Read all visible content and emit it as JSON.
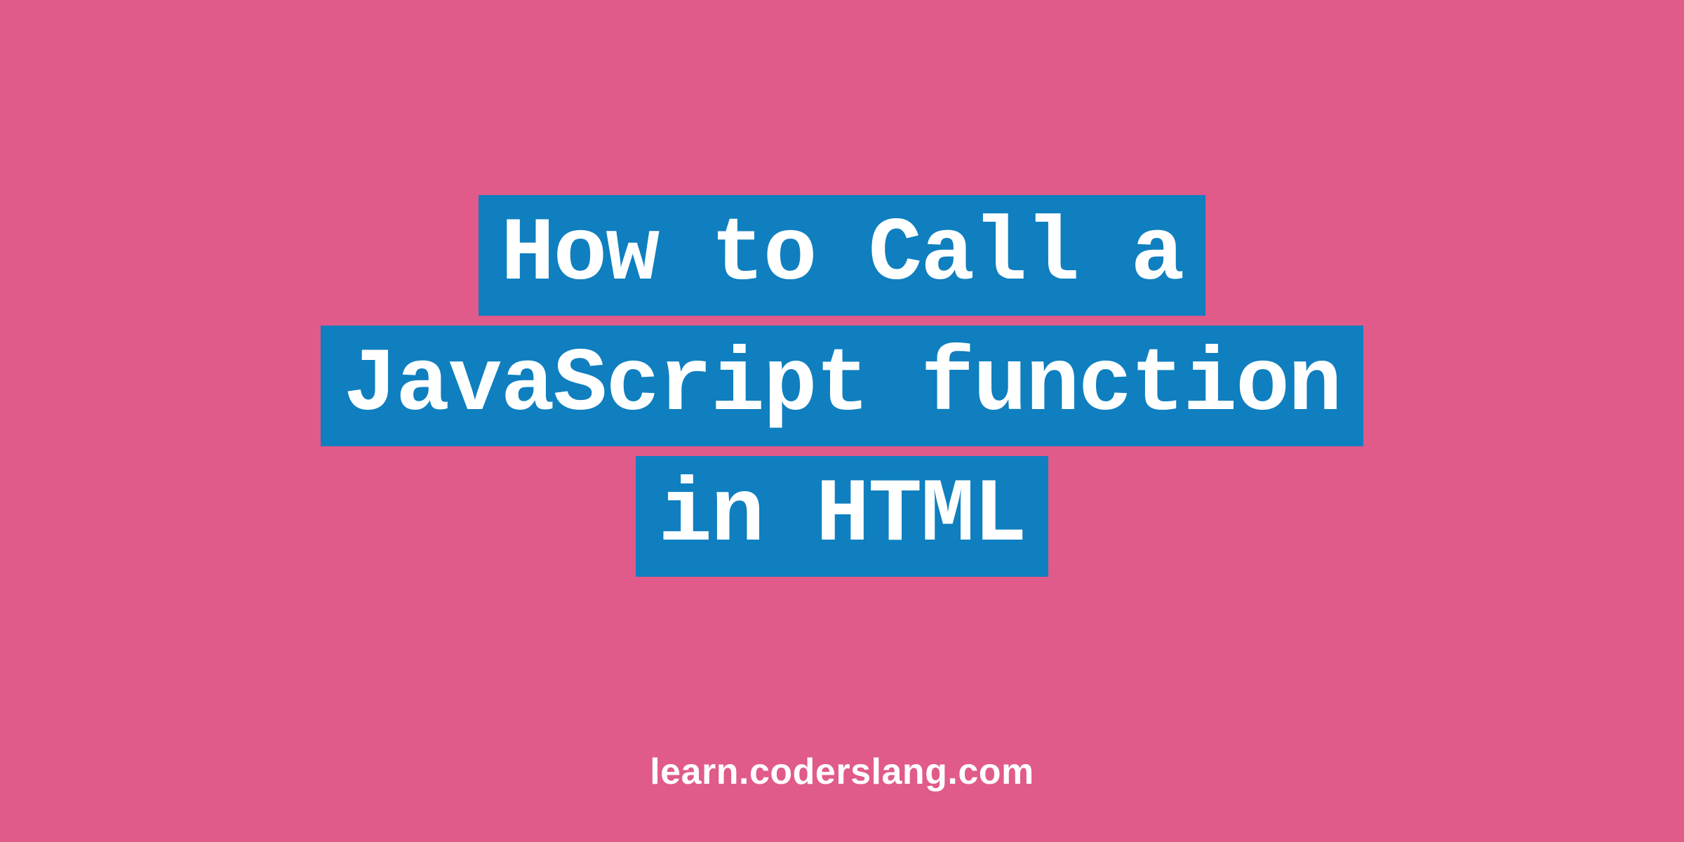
{
  "title": {
    "line1": "How to Call a",
    "line2": "JavaScript function",
    "line3": "in HTML"
  },
  "footer": {
    "text": "learn.coderslang.com"
  },
  "colors": {
    "background": "#e05a8a",
    "highlight": "#0f7fbf",
    "text": "#ffffff"
  }
}
